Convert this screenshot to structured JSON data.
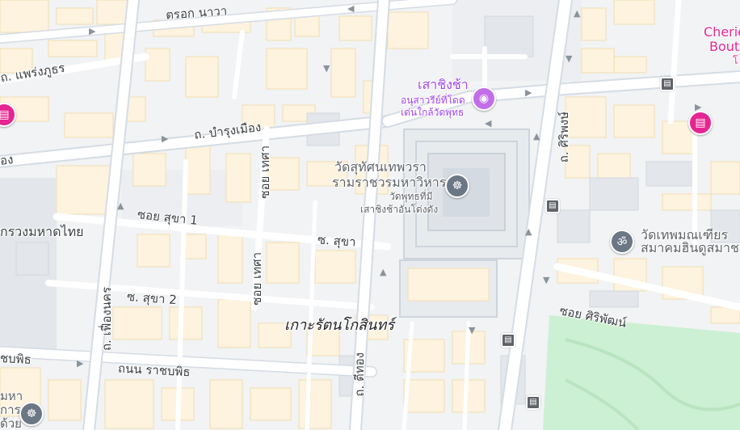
{
  "map": {
    "area_label": "เกาะรัตนโกสินทร์",
    "roads": {
      "tarok_nawa": "ตรอก นาวา",
      "phraeng_phuthon": "ถ. แพร่งภูธร",
      "bamrung_mueang": "ถ. บำรุงเมือง",
      "soi_sukha_1": "ซอย สุขา 1",
      "so_sukha": "ซ. สุขา",
      "so_sukha_2": "ซ. สุขา 2",
      "thanon_ratchabophit": "ถนน ราชบพิธ",
      "ratchabophit_left": "ชบพิธ",
      "fueang_nakhon": "ถ. เฟื่องนคร",
      "soi_thetsa_top": "ซอย เทศา",
      "soi_thetsa": "ซอย เทศา",
      "tithong": "ถ. ตีทอง",
      "siriphong": "ถ. ศิริพงษ์",
      "soi_siriphat": "ซอย ศิริพัฒน์",
      "mueang_left": "อง"
    },
    "pois": {
      "giant_swing": {
        "name": "เสาชิงช้า",
        "desc_1": "อนุสาวรีย์ที่โดด",
        "desc_2": "เด่นใกล้วัดพุทธ",
        "icon": "camera-icon"
      },
      "wat_suthat": {
        "name_1": "วัดสุทัศนเทพวรา",
        "name_2": "รามราชวรมหาวิหาร",
        "desc_1": "วัดพุทธที่มี",
        "desc_2": "เสาชิงช้าอันโด่งดัง",
        "icon": "dharma-wheel-icon"
      },
      "wat_thep": {
        "name_1": "วัดเทพมณเฑียร",
        "name_2": "สมาคมฮินดูสมาช",
        "icon": "om-icon"
      },
      "ministry": {
        "name": "กรวงมหาดไทย"
      },
      "cherie": {
        "name_1": "Cherie",
        "name_2": "Bout",
        "name_3": "โ"
      },
      "bottom_left": {
        "name_1": "มหา",
        "name_2": "การ",
        "name_3": "ด้วย",
        "icon": "dharma-wheel-icon"
      }
    },
    "colors": {
      "background": "#f1f3f4",
      "building": "#fdf3de",
      "building_edge": "#f1ddb3",
      "road_main": "#d5dce4",
      "road_minor": "#ffffff",
      "park": "#ccf0d3",
      "attraction_pin": "#c26ee8",
      "hotel_pin": "#e52592",
      "temple_pin": "#6b7785"
    }
  }
}
